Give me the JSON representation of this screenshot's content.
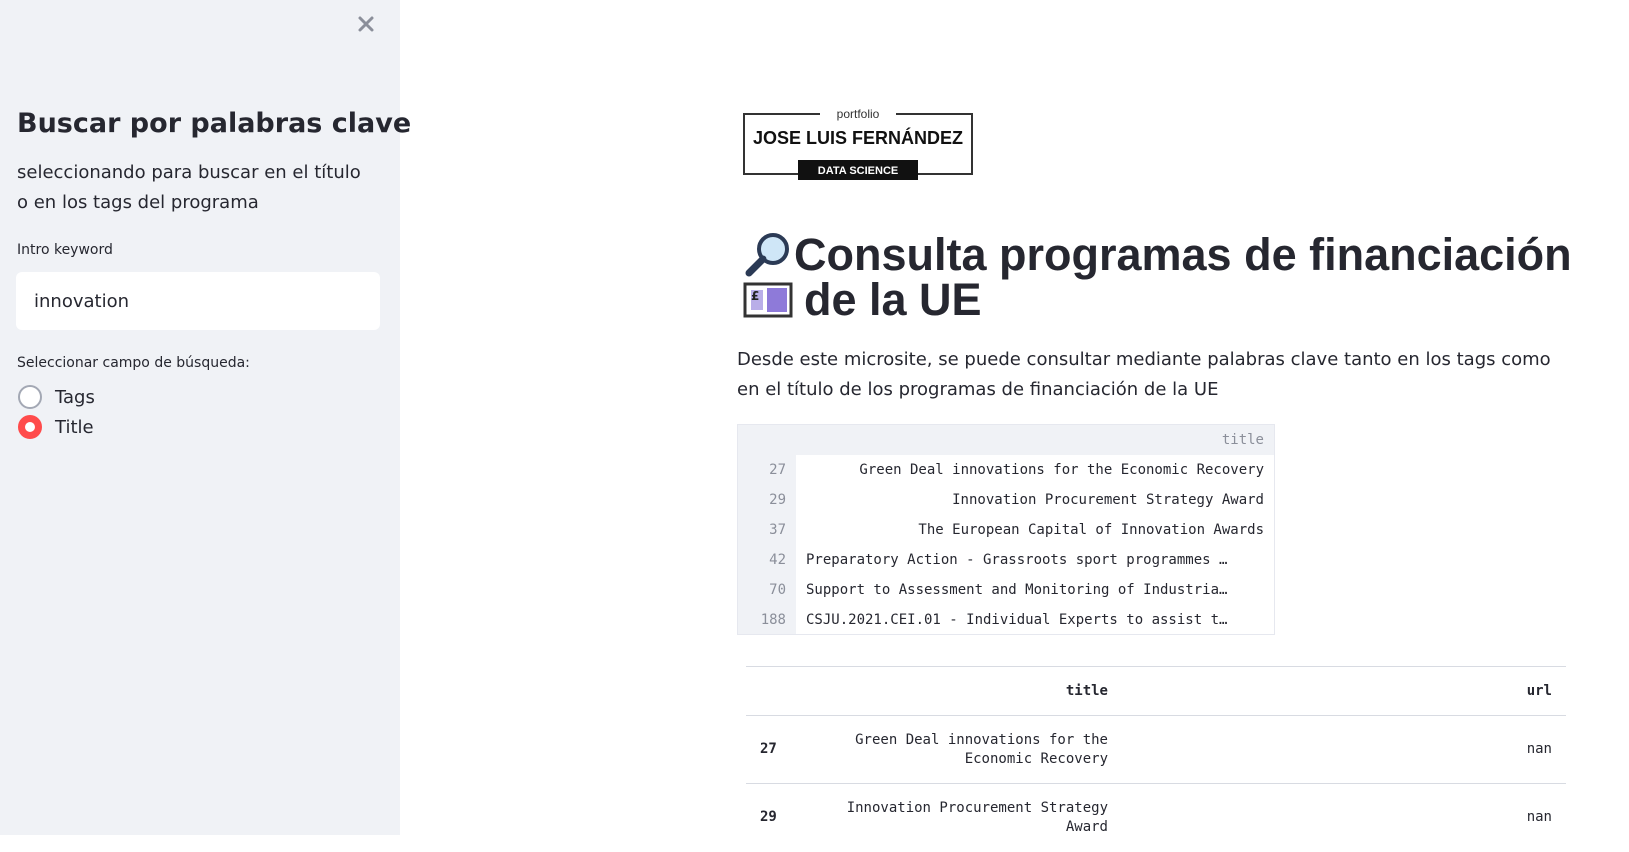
{
  "sidebar": {
    "title": "Buscar por palabras clave",
    "subtitle": "seleccionando para buscar en el título o en los tags del programa",
    "keyword_label": "Intro keyword",
    "keyword_value": "innovation",
    "field_label": "Seleccionar campo de búsqueda:",
    "options": [
      {
        "label": "Tags",
        "selected": false
      },
      {
        "label": "Title",
        "selected": true
      }
    ]
  },
  "logo": {
    "top_text": "portfolio",
    "name": "JOSE LUIS FERNÁNDEZ",
    "tag": "DATA SCIENCE"
  },
  "main": {
    "heading_line1": "Consulta programas de financiación",
    "heading_line2": "de la UE",
    "description": "Desde este microsite, se puede consultar mediante palabras clave tanto en los tags como en el título de los programas de financiación de la UE"
  },
  "dataframe": {
    "column": "title",
    "rows": [
      {
        "index": "27",
        "title": "Green Deal innovations for the Economic Recovery"
      },
      {
        "index": "29",
        "title": "Innovation Procurement Strategy Award"
      },
      {
        "index": "37",
        "title": "The European Capital of Innovation Awards"
      },
      {
        "index": "42",
        "title": "Preparatory Action - Grassroots sport programmes …"
      },
      {
        "index": "70",
        "title": "Support to Assessment and Monitoring of Industria…"
      },
      {
        "index": "188",
        "title": "CSJU.2021.CEI.01 - Individual Experts to assist t…"
      }
    ]
  },
  "table": {
    "headers": [
      "title",
      "url"
    ],
    "rows": [
      {
        "index": "27",
        "title": "Green Deal innovations for the Economic Recovery",
        "url": "nan"
      },
      {
        "index": "29",
        "title": "Innovation Procurement Strategy Award",
        "url": "nan"
      }
    ]
  },
  "colors": {
    "accent": "#ff4b4b",
    "sidebar_bg": "#f0f2f6",
    "text": "#262730"
  },
  "icons": {
    "close": "close-icon",
    "magnifier": "magnifying-glass-icon",
    "money": "pound-banknote-icon"
  }
}
